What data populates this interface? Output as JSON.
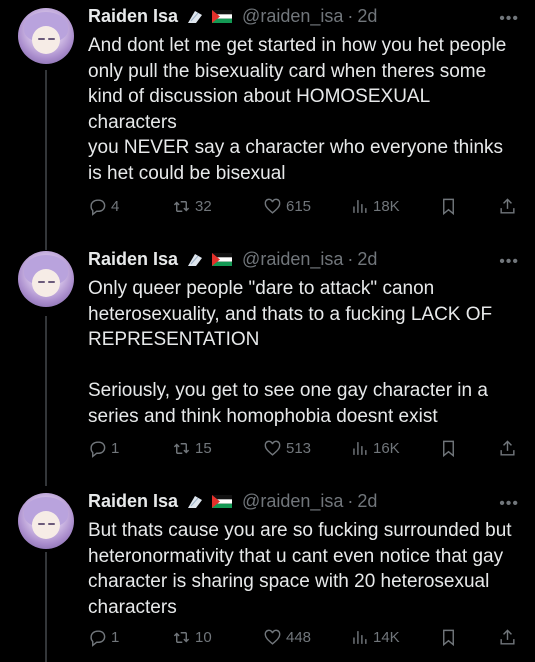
{
  "tweets": [
    {
      "name": "Raiden Isa",
      "handle": "@raiden_isa",
      "time": "2d",
      "text": "And dont let me get started in how you het people only pull the bisexuality card when theres some kind of discussion about HOMOSEXUAL characters\nyou NEVER say a character who everyone thinks is het could be bisexual",
      "replies": "4",
      "reposts": "32",
      "likes": "615",
      "views": "18K"
    },
    {
      "name": "Raiden Isa",
      "handle": "@raiden_isa",
      "time": "2d",
      "text": "Only queer people \"dare to attack\" canon heterosexuality, and thats to a fucking LACK OF REPRESENTATION\n\nSeriously, you get to see one gay character in a series and think homophobia doesnt exist",
      "replies": "1",
      "reposts": "15",
      "likes": "513",
      "views": "16K"
    },
    {
      "name": "Raiden Isa",
      "handle": "@raiden_isa",
      "time": "2d",
      "text": "But thats cause you are so fucking surrounded but heteronormativity that u cant even notice that gay character is sharing space with 20 heterosexual characters",
      "replies": "1",
      "reposts": "10",
      "likes": "448",
      "views": "14K"
    }
  ],
  "colors": {
    "background": "#000000",
    "text": "#e7e9ea",
    "muted": "#71767b",
    "thread_line": "#333639"
  },
  "icons": [
    "reply-icon",
    "repost-icon",
    "like-icon",
    "views-icon",
    "bookmark-icon",
    "share-icon",
    "more-icon",
    "verified-badge-icon",
    "flag-icon"
  ]
}
